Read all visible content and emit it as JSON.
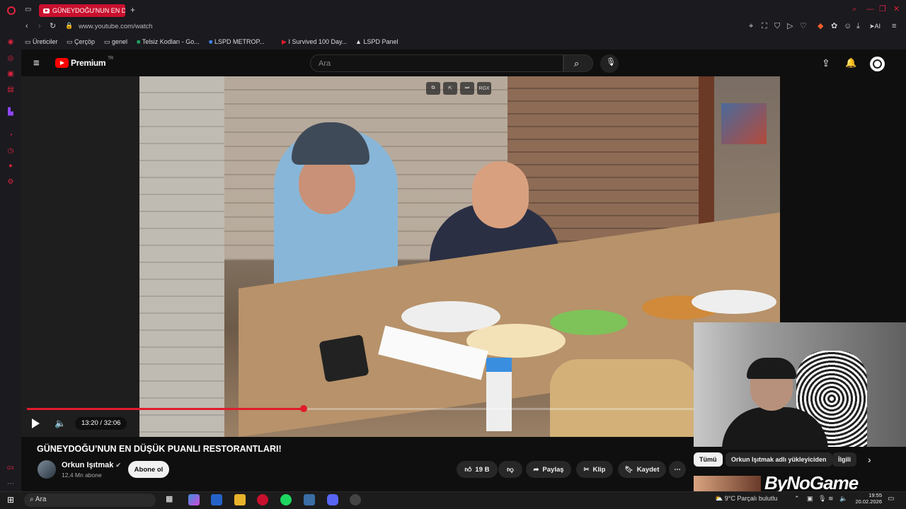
{
  "browser": {
    "tab_title": "GÜNEYDOĞU'NUN EN DÜŞ",
    "url": "www.youtube.com/watch",
    "ai_label": "AI",
    "bookmarks": [
      {
        "label": "Üreticiler",
        "icon": "folder-icon"
      },
      {
        "label": "Çerçöp",
        "icon": "folder-icon"
      },
      {
        "label": "genel",
        "icon": "folder-icon"
      },
      {
        "label": "Telsiz Kodları - Go...",
        "icon": "sheets-icon"
      },
      {
        "label": "LSPD METROP...",
        "icon": "docs-icon"
      },
      {
        "label": "I Survived 100 Day...",
        "icon": "youtube-icon"
      },
      {
        "label": "LSPD Panel",
        "icon": "triangle-icon"
      }
    ]
  },
  "youtube": {
    "brand": "Premium",
    "region": "TR",
    "search_placeholder": "Ara"
  },
  "player": {
    "current_time": "13:20",
    "duration": "32:06",
    "time_display": "13:20 / 32:06",
    "progress": 0.4154,
    "overlay_label": "RGX"
  },
  "video": {
    "title": "GÜNEYDOĞU’NUN EN DÜŞÜK PUANLI RESTORANTLARI!",
    "channel": "Orkun Işıtmak",
    "subscribers": "12,4 Mn abone",
    "subscribe_label": "Abone ol",
    "likes": "19 B",
    "share_label": "Paylaş",
    "clip_label": "Klip",
    "save_label": "Kaydet"
  },
  "recommend": {
    "chips": [
      "Tümü",
      "Orkun Işıtmak adlı yükleyiciden",
      "İlgili"
    ]
  },
  "overlay": {
    "watermark": "ByNoGame"
  },
  "taskbar": {
    "search_label": "Ara",
    "weather": "9°C  Parçalı bulutlu",
    "time": "19:55",
    "date": "20.02.2026"
  },
  "colors": {
    "accent": "#e01c2c",
    "opera_red": "#c8102e"
  }
}
